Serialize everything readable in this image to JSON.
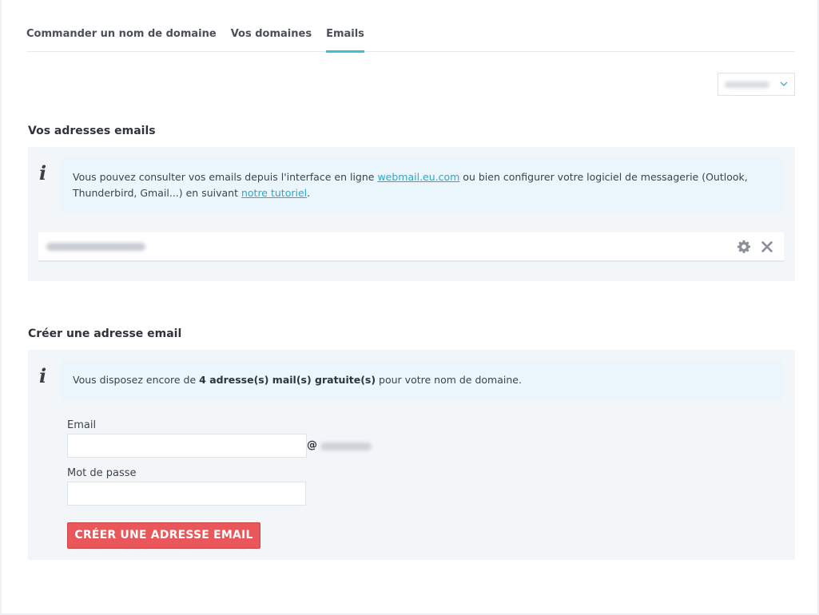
{
  "tabs": [
    {
      "label": "Commander un nom de domaine"
    },
    {
      "label": "Vos domaines"
    },
    {
      "label": "Emails",
      "active": true
    }
  ],
  "domain_select": {
    "value": "",
    "icon": "chevron-down-icon"
  },
  "emails_section": {
    "title": "Vos adresses emails",
    "info": {
      "icon": "info-icon",
      "icon_glyph": "i",
      "text_before": "Vous pouvez consulter vos emails depuis l'interface en ligne ",
      "link1": "webmail.eu.com",
      "text_middle": " ou bien configurer votre logiciel de messagerie (Outlook, Thunderbird, Gmail...) en suivant ",
      "link2": "notre tutoriel",
      "text_after": "."
    },
    "email_row": {
      "address": "",
      "settings_icon": "gear-icon",
      "delete_icon": "close-icon"
    }
  },
  "create_section": {
    "title": "Créer une adresse email",
    "info": {
      "icon": "info-icon",
      "icon_glyph": "i",
      "text_before": "Vous disposez encore de ",
      "highlight": "4 adresse(s) mail(s) gratuite(s)",
      "text_after": " pour votre nom de domaine."
    },
    "email_label": "Email",
    "email_value": "",
    "at": "@",
    "domain": "",
    "password_label": "Mot de passe",
    "password_value": "",
    "submit_label": "CRÉER UNE ADRESSE EMAIL"
  },
  "colors": {
    "accent": "#3bc1d8",
    "link": "#2ea7c7",
    "button": "#e9575b",
    "panel_bg": "#f3f6f9",
    "info_bg": "#eaf6fb"
  }
}
